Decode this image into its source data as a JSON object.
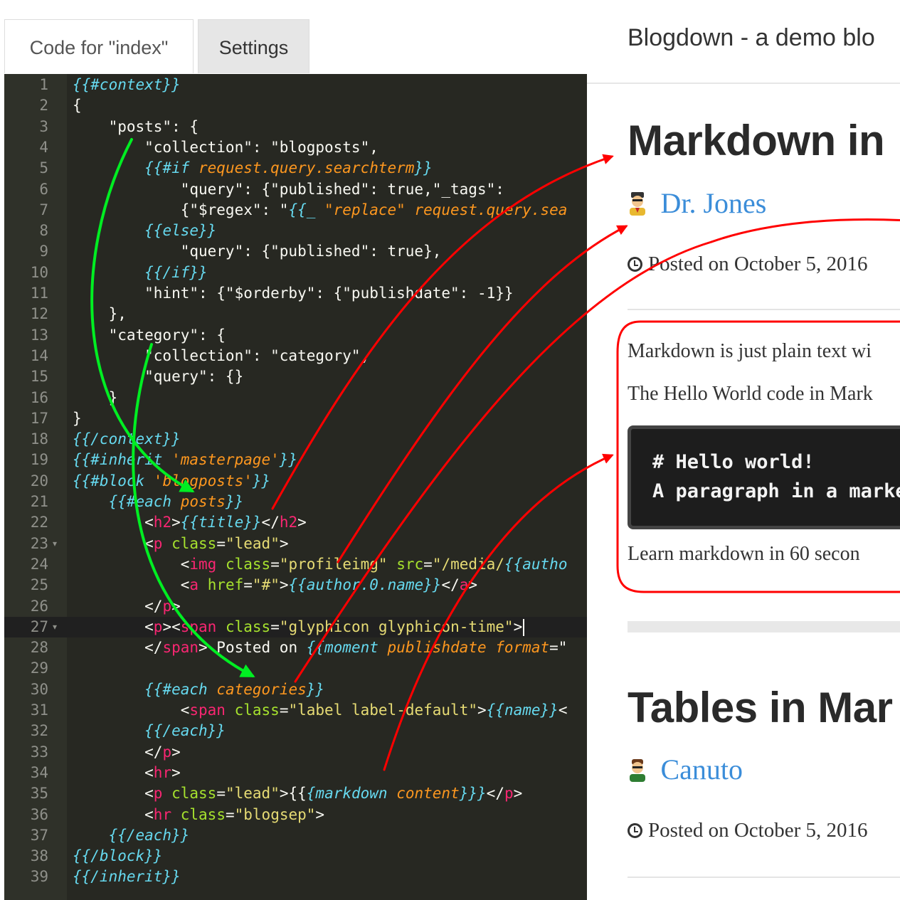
{
  "tabs": [
    {
      "label": "Code for \"index\"",
      "active": true
    },
    {
      "label": "Settings",
      "active": false
    }
  ],
  "editor": {
    "theme": "monokai",
    "active_line": 27,
    "lines": [
      [
        [
          "t",
          "{{#context}}"
        ]
      ],
      [
        [
          "p",
          "{"
        ]
      ],
      [
        [
          "p",
          "    \"posts\": {"
        ]
      ],
      [
        [
          "p",
          "        \"collection\": \"blogposts\","
        ]
      ],
      [
        [
          "p",
          "        "
        ],
        [
          "t",
          "{{#if "
        ],
        [
          "o",
          "request.query.searchterm"
        ],
        [
          "t",
          "}}"
        ]
      ],
      [
        [
          "p",
          "            \"query\": {\"published\": true,\"_tags\":"
        ]
      ],
      [
        [
          "p",
          "            {\"$regex\": \""
        ],
        [
          "t",
          "{{_ "
        ],
        [
          "o",
          "\"replace\" request.query.sea"
        ]
      ],
      [
        [
          "p",
          "        "
        ],
        [
          "t",
          "{{else}}"
        ]
      ],
      [
        [
          "p",
          "            \"query\": {\"published\": true},"
        ]
      ],
      [
        [
          "p",
          "        "
        ],
        [
          "t",
          "{{/if}}"
        ]
      ],
      [
        [
          "p",
          "        \"hint\": {\"$orderby\": {\"publishdate\": -1}}"
        ]
      ],
      [
        [
          "p",
          "    },"
        ]
      ],
      [
        [
          "p",
          "    \"category\": {"
        ]
      ],
      [
        [
          "p",
          "        \"collection\": \"category\","
        ]
      ],
      [
        [
          "p",
          "        \"query\": {}"
        ]
      ],
      [
        [
          "p",
          "    }"
        ]
      ],
      [
        [
          "p",
          "}"
        ]
      ],
      [
        [
          "t",
          "{{/context}}"
        ]
      ],
      [
        [
          "t",
          "{{#inherit "
        ],
        [
          "o",
          "'masterpage'"
        ],
        [
          "t",
          "}}"
        ]
      ],
      [
        [
          "t",
          "{{#block "
        ],
        [
          "o",
          "'blogposts'"
        ],
        [
          "t",
          "}}"
        ]
      ],
      [
        [
          "p",
          "    "
        ],
        [
          "t",
          "{{#each "
        ],
        [
          "o",
          "posts"
        ],
        [
          "t",
          "}}"
        ]
      ],
      [
        [
          "p",
          "        <"
        ],
        [
          "tg",
          "h2"
        ],
        [
          "p",
          ">"
        ],
        [
          "t",
          "{{title}}"
        ],
        [
          "p",
          "</"
        ],
        [
          "tg",
          "h2"
        ],
        [
          "p",
          ">"
        ]
      ],
      [
        [
          "p",
          "        <"
        ],
        [
          "tg",
          "p"
        ],
        [
          "p",
          " "
        ],
        [
          "at",
          "class"
        ],
        [
          "p",
          "="
        ],
        [
          "s",
          "\"lead\""
        ],
        [
          "p",
          ">"
        ]
      ],
      [
        [
          "p",
          "            <"
        ],
        [
          "tg",
          "img"
        ],
        [
          "p",
          " "
        ],
        [
          "at",
          "class"
        ],
        [
          "p",
          "="
        ],
        [
          "s",
          "\"profileimg\""
        ],
        [
          "p",
          " "
        ],
        [
          "at",
          "src"
        ],
        [
          "p",
          "="
        ],
        [
          "s",
          "\"/media/"
        ],
        [
          "t",
          "{{autho"
        ]
      ],
      [
        [
          "p",
          "            <"
        ],
        [
          "tg",
          "a"
        ],
        [
          "p",
          " "
        ],
        [
          "at",
          "href"
        ],
        [
          "p",
          "="
        ],
        [
          "s",
          "\"#\""
        ],
        [
          "p",
          ">"
        ],
        [
          "t",
          "{{author.0.name}}"
        ],
        [
          "p",
          "</"
        ],
        [
          "tg",
          "a"
        ],
        [
          "p",
          ">"
        ]
      ],
      [
        [
          "p",
          "        </"
        ],
        [
          "tg",
          "p"
        ],
        [
          "p",
          ">"
        ]
      ],
      [
        [
          "p",
          "        <"
        ],
        [
          "tg",
          "p"
        ],
        [
          "p",
          "><"
        ],
        [
          "tg",
          "span"
        ],
        [
          "p",
          " "
        ],
        [
          "at",
          "class"
        ],
        [
          "p",
          "="
        ],
        [
          "s",
          "\"glyphicon glyphicon-time\""
        ],
        [
          "p",
          ">"
        ]
      ],
      [
        [
          "p",
          "        </"
        ],
        [
          "tg",
          "span"
        ],
        [
          "p",
          "> Posted on "
        ],
        [
          "t",
          "{{moment "
        ],
        [
          "o",
          "publishdate format"
        ],
        [
          "p",
          "=\""
        ]
      ],
      [
        [
          "p",
          ""
        ]
      ],
      [
        [
          "p",
          "        "
        ],
        [
          "t",
          "{{#each "
        ],
        [
          "o",
          "categories"
        ],
        [
          "t",
          "}}"
        ]
      ],
      [
        [
          "p",
          "            <"
        ],
        [
          "tg",
          "span"
        ],
        [
          "p",
          " "
        ],
        [
          "at",
          "class"
        ],
        [
          "p",
          "="
        ],
        [
          "s",
          "\"label label-default\""
        ],
        [
          "p",
          ">"
        ],
        [
          "t",
          "{{name}}"
        ],
        [
          "p",
          "<"
        ]
      ],
      [
        [
          "p",
          "        "
        ],
        [
          "t",
          "{{/each}}"
        ]
      ],
      [
        [
          "p",
          "        </"
        ],
        [
          "tg",
          "p"
        ],
        [
          "p",
          ">"
        ]
      ],
      [
        [
          "p",
          "        <"
        ],
        [
          "tg",
          "hr"
        ],
        [
          "p",
          ">"
        ]
      ],
      [
        [
          "p",
          "        <"
        ],
        [
          "tg",
          "p"
        ],
        [
          "p",
          " "
        ],
        [
          "at",
          "class"
        ],
        [
          "p",
          "="
        ],
        [
          "s",
          "\"lead\""
        ],
        [
          "p",
          ">{{"
        ],
        [
          "t",
          "{markdown "
        ],
        [
          "o",
          "content"
        ],
        [
          "t",
          "}}}"
        ],
        [
          "p",
          "</"
        ],
        [
          "tg",
          "p"
        ],
        [
          "p",
          ">"
        ]
      ],
      [
        [
          "p",
          "        <"
        ],
        [
          "tg",
          "hr"
        ],
        [
          "p",
          " "
        ],
        [
          "at",
          "class"
        ],
        [
          "p",
          "="
        ],
        [
          "s",
          "\"blogsep\""
        ],
        [
          "p",
          ">"
        ]
      ],
      [
        [
          "p",
          "    "
        ],
        [
          "t",
          "{{/each}}"
        ]
      ],
      [
        [
          "t",
          "{{/block}}"
        ]
      ],
      [
        [
          "t",
          "{{/inherit}}"
        ]
      ]
    ],
    "folds": [
      23,
      27
    ],
    "colors": {
      "background": "#272822",
      "gutter": "#2f3129",
      "tag": "#f92672",
      "attr": "#a6e22e",
      "string": "#e6db74",
      "helper": "#66d9ef",
      "param": "#fd971f"
    }
  },
  "preview": {
    "brand": "Blogdown - a demo blo",
    "posts": [
      {
        "title": "Markdown in",
        "author": "Dr. Jones",
        "posted": "Posted on October 5, 2016",
        "paragraphs": [
          "Markdown is just plain text wi",
          "The Hello World code in Mark"
        ],
        "code": [
          "# Hello world!",
          "A paragraph in a marke"
        ],
        "footer": "Learn markdown in 60 secon"
      },
      {
        "title": "Tables in Mar",
        "author": "Canuto",
        "posted": "Posted on October 5, 2016"
      }
    ],
    "link_color": "#3b8dd9"
  },
  "annotations": {
    "green_color": "#00ee22",
    "red_color": "#ff0000"
  }
}
